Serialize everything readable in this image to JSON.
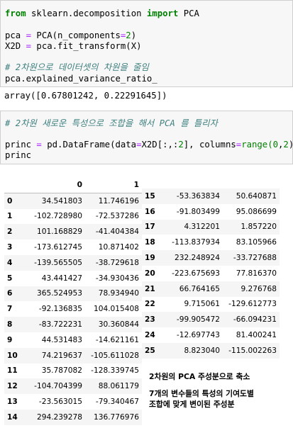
{
  "cell1": {
    "line1_kw1": "from",
    "line1_mod": " sklearn.decomposition ",
    "line1_kw2": "import",
    "line1_name": " PCA",
    "line3_a": "pca ",
    "line3_eq": "=",
    "line3_b": " PCA(n_components",
    "line3_eq2": "=",
    "line3_num": "2",
    "line3_c": ")",
    "line4_a": "X2D ",
    "line4_eq": "=",
    "line4_b": " pca.fit_transform(X)",
    "comment": "# 2차원으로 데이터셋의 차원을 줄임",
    "line7": "pca.explained_variance_ratio_"
  },
  "output1": "array([0.67801242, 0.22291645])",
  "cell2": {
    "comment": "# 2차원 새로운 특성으로 조합을 해서 PCA 를 틀리자",
    "line3_a": "princ ",
    "line3_eq": "=",
    "line3_b": " pd.DataFrame(data",
    "line3_eq2": "=",
    "line3_c": "X2D[:,:",
    "line3_num": "2",
    "line3_d": "], columns",
    "line3_eq3": "=",
    "line3_e": "range(",
    "line3_num2": "0",
    "line3_f": ",",
    "line3_num3": "2",
    "line3_g": "))",
    "line4": "princ"
  },
  "table": {
    "columns": [
      "",
      "0",
      "1"
    ],
    "rows_left": [
      [
        "0",
        "34.541803",
        "11.746196"
      ],
      [
        "1",
        "-102.728980",
        "-72.537286"
      ],
      [
        "2",
        "101.168829",
        "-41.404384"
      ],
      [
        "3",
        "-173.612745",
        "10.871402"
      ],
      [
        "4",
        "-139.565505",
        "-38.729618"
      ],
      [
        "5",
        "43.441427",
        "-34.930436"
      ],
      [
        "6",
        "365.524953",
        "78.934940"
      ],
      [
        "7",
        "-92.136835",
        "104.015408"
      ],
      [
        "8",
        "-83.722231",
        "30.360844"
      ],
      [
        "9",
        "44.531483",
        "-14.621161"
      ],
      [
        "10",
        "74.219637",
        "-105.611028"
      ],
      [
        "11",
        "35.787082",
        "-128.339745"
      ],
      [
        "12",
        "-104.704399",
        "88.061179"
      ],
      [
        "13",
        "-23.563015",
        "-79.340467"
      ],
      [
        "14",
        "294.239278",
        "136.776976"
      ]
    ],
    "rows_right": [
      [
        "15",
        "-53.363834",
        "50.640871"
      ],
      [
        "16",
        "-91.803499",
        "95.086699"
      ],
      [
        "17",
        "4.312201",
        "1.857220"
      ],
      [
        "18",
        "-113.837934",
        "83.105966"
      ],
      [
        "19",
        "232.248924",
        "-33.727688"
      ],
      [
        "20",
        "-223.675693",
        "77.816370"
      ],
      [
        "21",
        "66.764165",
        "9.276768"
      ],
      [
        "22",
        "9.715061",
        "-129.612773"
      ],
      [
        "23",
        "-99.905472",
        "-66.094231"
      ],
      [
        "24",
        "-12.697743",
        "81.400241"
      ],
      [
        "25",
        "8.823040",
        "-115.002263"
      ]
    ]
  },
  "notes": {
    "note1": "2차원의 PCA 주성분으로 축소",
    "note2_line1": "7개의 변수들의 특성의 기여도별",
    "note2_line2": "조합에 맞게 변이된 주성분"
  }
}
